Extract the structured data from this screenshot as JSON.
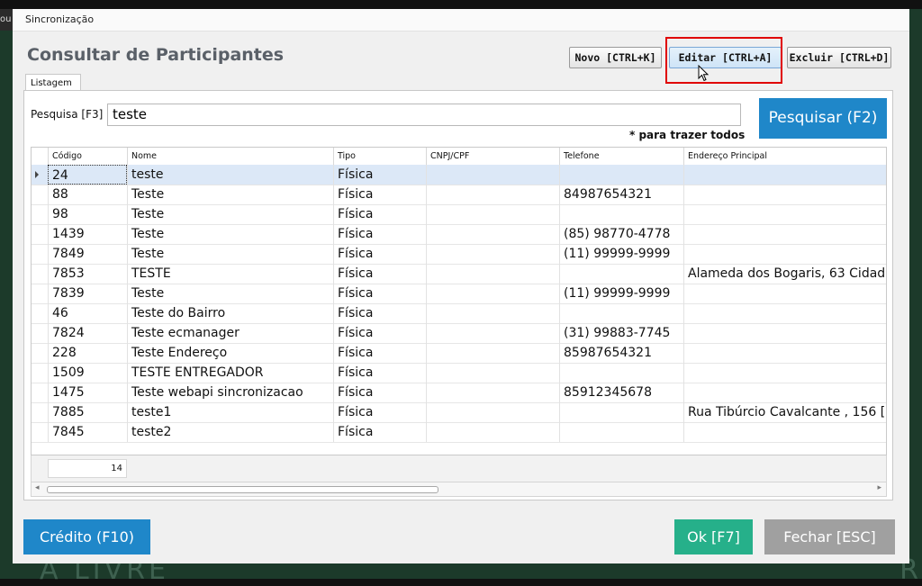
{
  "background": {
    "left_label": "ou",
    "bottom_text": "A LIVRE",
    "bottom_right_text": "R"
  },
  "window": {
    "title": "Sincronização"
  },
  "page": {
    "heading": "Consultar de Participantes"
  },
  "toolbar": {
    "novo": "Novo [CTRL+K]",
    "editar": "Editar [CTRL+A]",
    "excluir": "Excluir [CTRL+D]"
  },
  "tabs": {
    "listagem": "Listagem"
  },
  "search": {
    "label": "Pesquisa [F3]",
    "value": "teste",
    "hint": "* para trazer todos",
    "button": "Pesquisar (F2)"
  },
  "grid": {
    "headers": {
      "codigo": "Código",
      "nome": "Nome",
      "tipo": "Tipo",
      "cnpj": "CNPJ/CPF",
      "telefone": "Telefone",
      "endereco": "Endereço Principal"
    },
    "rows": [
      {
        "codigo": "24",
        "nome": "teste",
        "tipo": "Física",
        "cnpj": "",
        "telefone": "",
        "endereco": ""
      },
      {
        "codigo": "88",
        "nome": "Teste",
        "tipo": "Física",
        "cnpj": "",
        "telefone": "84987654321",
        "endereco": ""
      },
      {
        "codigo": "98",
        "nome": "Teste",
        "tipo": "Física",
        "cnpj": "",
        "telefone": "",
        "endereco": ""
      },
      {
        "codigo": "1439",
        "nome": "Teste",
        "tipo": "Física",
        "cnpj": "",
        "telefone": "(85) 98770-4778",
        "endereco": ""
      },
      {
        "codigo": "7849",
        "nome": "Teste",
        "tipo": "Física",
        "cnpj": "",
        "telefone": "(11) 99999-9999",
        "endereco": ""
      },
      {
        "codigo": "7853",
        "nome": "TESTE",
        "tipo": "Física",
        "cnpj": "",
        "telefone": "",
        "endereco": "Alameda dos Bogaris, 63  Cidad"
      },
      {
        "codigo": "7839",
        "nome": "Teste",
        "tipo": "Física",
        "cnpj": "",
        "telefone": "(11) 99999-9999",
        "endereco": ""
      },
      {
        "codigo": "46",
        "nome": "Teste do Bairro",
        "tipo": "Física",
        "cnpj": "",
        "telefone": "",
        "endereco": ""
      },
      {
        "codigo": "7824",
        "nome": "Teste ecmanager",
        "tipo": "Física",
        "cnpj": "",
        "telefone": "(31) 99883-7745",
        "endereco": ""
      },
      {
        "codigo": "228",
        "nome": "Teste Endereço",
        "tipo": "Física",
        "cnpj": "",
        "telefone": "85987654321",
        "endereco": ""
      },
      {
        "codigo": "1509",
        "nome": "TESTE ENTREGADOR",
        "tipo": "Física",
        "cnpj": "",
        "telefone": "",
        "endereco": ""
      },
      {
        "codigo": "1475",
        "nome": "Teste webapi sincronizacao",
        "tipo": "Física",
        "cnpj": "",
        "telefone": "85912345678",
        "endereco": ""
      },
      {
        "codigo": "7885",
        "nome": "teste1",
        "tipo": "Física",
        "cnpj": "",
        "telefone": "",
        "endereco": "Rua Tibúrcio Cavalcante , 156  ["
      },
      {
        "codigo": "7845",
        "nome": "teste2",
        "tipo": "Física",
        "cnpj": "",
        "telefone": "",
        "endereco": ""
      }
    ],
    "count": "14"
  },
  "footer": {
    "credito": "Crédito (F10)",
    "ok": "Ok [F7]",
    "fechar": "Fechar [ESC]"
  },
  "colors": {
    "primary_button": "#1f87c9",
    "ok_button": "#26b08a",
    "close_button": "#a0a0a0",
    "highlight_box": "#e00000",
    "selected_row": "#dce8f7"
  }
}
